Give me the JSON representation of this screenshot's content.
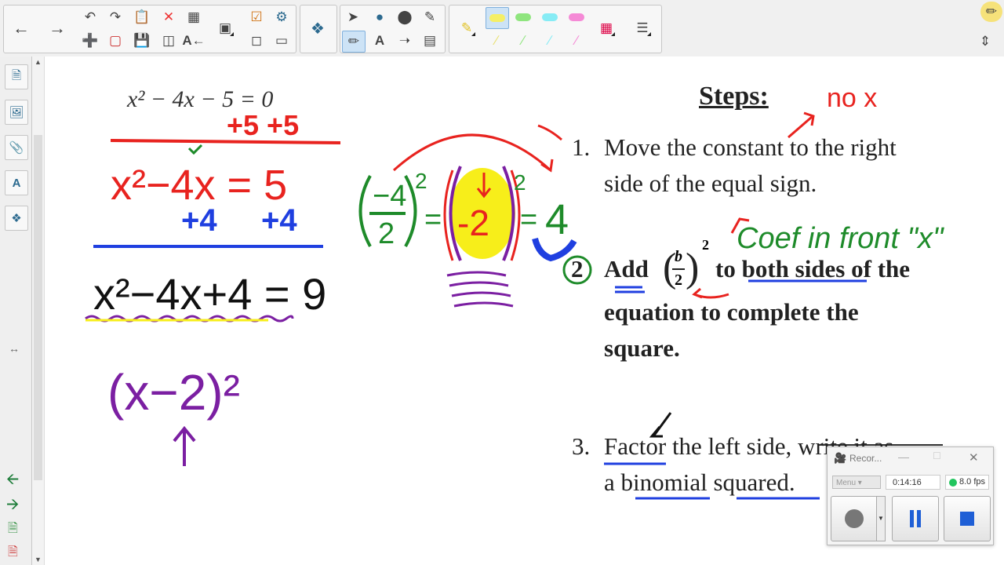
{
  "toolbar": {
    "icons": [
      "back-arrow-icon",
      "forward-arrow-icon",
      "undo-icon",
      "redo-icon",
      "delete-icon",
      "table-icon",
      "capture-icon",
      "screen-shade-icon",
      "record-icon",
      "settings-icon",
      "select-arrow-icon",
      "shape-icon",
      "fill-icon",
      "eraser-icon",
      "pen-icon",
      "highlighter-icon",
      "color-palette-icon",
      "lines-icon",
      "text-icon"
    ],
    "text_tool_label": "A"
  },
  "math": {
    "original_equation": "x² − 4x − 5 = 0",
    "step_add5": "+5 +5",
    "moved_equation": "x²−4x = 5",
    "add4_left": "+4",
    "add4_right": "+4",
    "completed_equation": "x²−4x+4 = 9",
    "factored": "(x−2)²",
    "fraction_expr": "(−4/2)² = (−2)² = 4"
  },
  "steps": {
    "heading": "Steps:",
    "note_no_x": "no x",
    "coef_note": "Coef in front \"x\"",
    "step1_num": "1.",
    "step1_line1": "Move the constant to the right",
    "step1_line2": "side of the equal sign.",
    "step2_circle": "2",
    "step2_add": "Add",
    "step2_b": "b",
    "step2_two": "2",
    "step2_exp": "2",
    "step2_rest": "to both sides of the",
    "step2_line2": "equation to complete the",
    "step2_line3": "square.",
    "step3_num": "3.",
    "step3_line1": "Factor the left side, write it as",
    "step3_line2": "a binomial squared."
  },
  "recorder": {
    "title": "Recor...",
    "menu_label": "Menu",
    "time": "0:14:16",
    "fps": "8.0 fps",
    "status_color": "#22c55e"
  },
  "colors": {
    "red": "#e8231f",
    "blue": "#1f3fe0",
    "green": "#1e8b2a",
    "purple": "#7b1fa2",
    "yellow": "#f7ee1a"
  }
}
